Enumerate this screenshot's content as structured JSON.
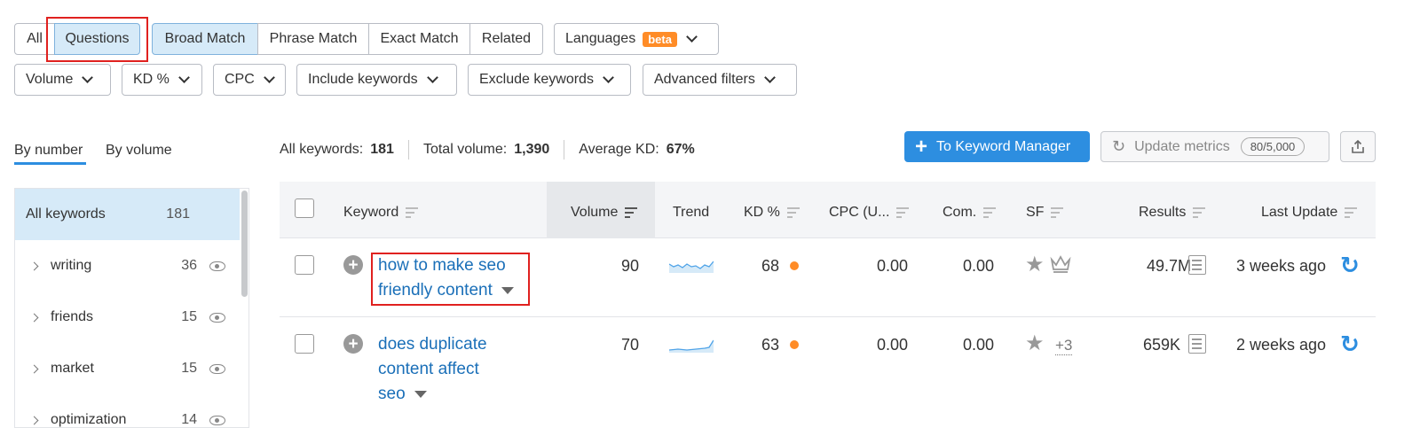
{
  "filters": {
    "tabs": [
      "All",
      "Questions"
    ],
    "match": [
      "Broad Match",
      "Phrase Match",
      "Exact Match",
      "Related"
    ],
    "languages": {
      "label": "Languages",
      "badge": "beta"
    },
    "dropdowns": [
      "Volume",
      "KD %",
      "CPC",
      "Include keywords",
      "Exclude keywords",
      "Advanced filters"
    ]
  },
  "view_tabs": {
    "by_number": "By number",
    "by_volume": "By volume"
  },
  "summary": {
    "all_keywords_label": "All keywords:",
    "all_keywords_value": "181",
    "total_volume_label": "Total volume:",
    "total_volume_value": "1,390",
    "avg_kd_label": "Average KD:",
    "avg_kd_value": "67%"
  },
  "actions": {
    "keyword_manager": "To Keyword Manager",
    "update_metrics": "Update metrics",
    "update_metrics_count": "80/5,000"
  },
  "sidebar": {
    "items": [
      {
        "label": "All keywords",
        "count": "181"
      },
      {
        "label": "writing",
        "count": "36"
      },
      {
        "label": "friends",
        "count": "15"
      },
      {
        "label": "market",
        "count": "15"
      },
      {
        "label": "optimization",
        "count": "14"
      }
    ]
  },
  "table": {
    "columns": [
      "Keyword",
      "Volume",
      "Trend",
      "KD %",
      "CPC (U...",
      "Com.",
      "SF",
      "Results",
      "Last Update"
    ],
    "rows": [
      {
        "keyword_l1": "how to make seo",
        "keyword_l2": "friendly content",
        "keyword_l3": "",
        "volume": "90",
        "kd": "68",
        "cpc": "0.00",
        "com": "0.00",
        "sf_extra": "",
        "results": "49.7M",
        "updated": "3 weeks ago"
      },
      {
        "keyword_l1": "does duplicate",
        "keyword_l2": "content affect",
        "keyword_l3": "seo",
        "volume": "70",
        "kd": "63",
        "cpc": "0.00",
        "com": "0.00",
        "sf_extra": "+3",
        "results": "659K",
        "updated": "2 weeks ago"
      }
    ]
  },
  "colors": {
    "accent": "#2d8ee0",
    "link": "#1a6fb8",
    "kd_dot": "#ff8c27",
    "highlight": "#e0211f",
    "active_bg": "#d6eaf8"
  }
}
